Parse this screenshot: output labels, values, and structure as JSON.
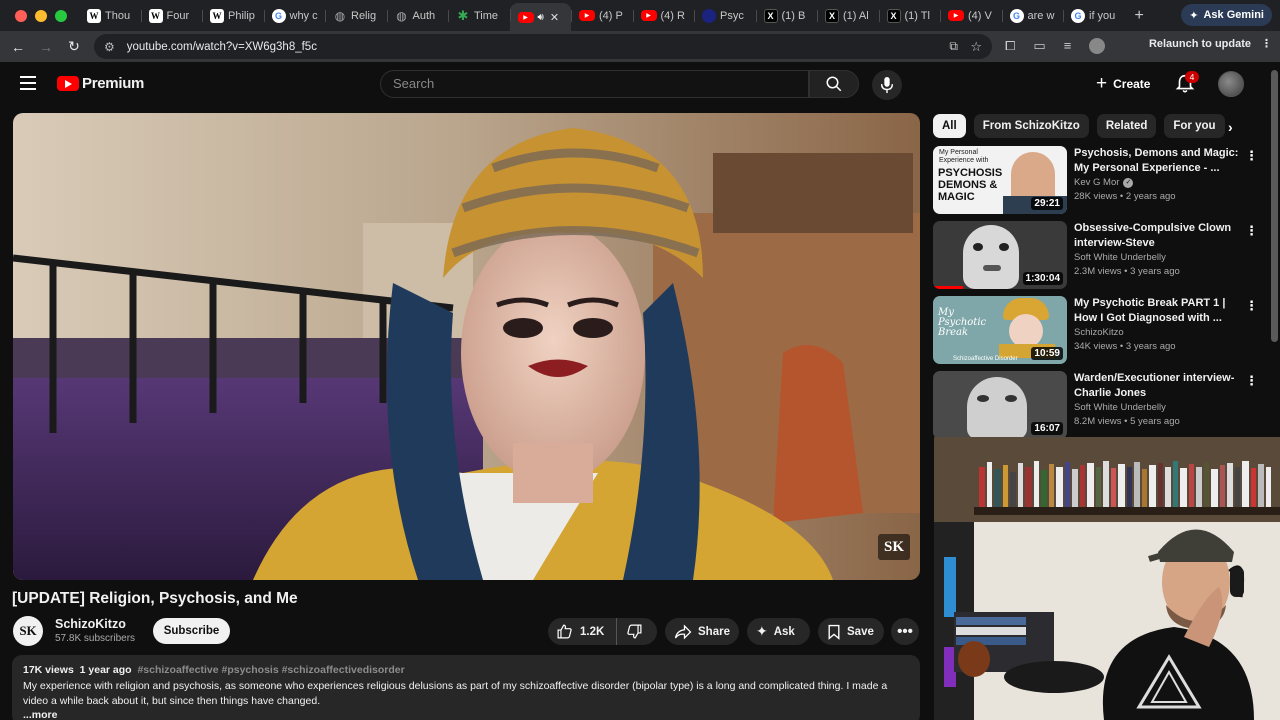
{
  "browser": {
    "tabs": [
      {
        "label": "Thou",
        "favicon": "wikipedia-icon"
      },
      {
        "label": "Four",
        "favicon": "wikipedia-icon"
      },
      {
        "label": "Philip",
        "favicon": "wikipedia-icon"
      },
      {
        "label": "why c",
        "favicon": "google-icon"
      },
      {
        "label": "Relig",
        "favicon": "globe-icon"
      },
      {
        "label": "Auth",
        "favicon": "globe-icon"
      },
      {
        "label": "Time",
        "favicon": "leaf-icon"
      },
      {
        "label": "",
        "favicon": "youtube-icon",
        "active": true
      },
      {
        "label": "(4) P",
        "favicon": "youtube-icon"
      },
      {
        "label": "(4) R",
        "favicon": "youtube-icon"
      },
      {
        "label": "Psyc",
        "favicon": "psych-icon"
      },
      {
        "label": "(1) B",
        "favicon": "x-icon"
      },
      {
        "label": "(1) Al",
        "favicon": "x-icon"
      },
      {
        "label": "(1) Tl",
        "favicon": "x-icon"
      },
      {
        "label": "(4) V",
        "favicon": "youtube-icon"
      },
      {
        "label": "are w",
        "favicon": "google-icon"
      },
      {
        "label": "if you",
        "favicon": "google-icon"
      }
    ],
    "ask_gemini": "Ask Gemini",
    "url": "youtube.com/watch?v=XW6g3h8_f5c",
    "relaunch": "Relaunch to update"
  },
  "youtube": {
    "logo_text": "Premium",
    "search_placeholder": "Search",
    "create_label": "Create",
    "notification_count": "4"
  },
  "video": {
    "title": "[UPDATE] Religion, Psychosis, and Me",
    "watermark": "SK",
    "channel": {
      "avatar_text": "SK",
      "name": "SchizoKitzo",
      "subscribers": "57.8K subscribers"
    },
    "subscribe_label": "Subscribe",
    "like_count": "1.2K",
    "share_label": "Share",
    "ask_label": "Ask",
    "save_label": "Save",
    "description": {
      "views": "17K views",
      "age": "1 year ago",
      "tags": "#schizoaffective #psychosis #schizoaffectivedisorder",
      "text": "My experience with religion and psychosis, as someone who experiences religious delusions as part of my schizoaffective disorder (bipolar type) is a long and complicated thing. I made a video a while back about it, but since then things have changed.",
      "more": "...more"
    }
  },
  "sidebar": {
    "chips": [
      "All",
      "From SchizoKitzo",
      "Related",
      "For you"
    ],
    "recommendations": [
      {
        "title": "Psychosis, Demons and Magic: My Personal Experience - ...",
        "channel": "Kev G Mor",
        "verified": true,
        "meta": "28K views • 2 years ago",
        "duration": "29:21",
        "thumb_text": [
          "My Personal",
          "Experience with",
          "PSYCHOSIS",
          "DEMONS &",
          "MAGIC"
        ]
      },
      {
        "title": "Obsessive-Compulsive Clown interview-Steve",
        "channel": "Soft White Underbelly",
        "verified": false,
        "meta": "2.3M views • 3 years ago",
        "duration": "1:30:04"
      },
      {
        "title": "My Psychotic Break PART 1 | How I Got Diagnosed with ...",
        "channel": "SchizoKitzo",
        "verified": false,
        "meta": "34K views • 3 years ago",
        "duration": "10:59",
        "thumb_text": [
          "My",
          "Psychotic",
          "Break",
          "Schizoaffective Disorder"
        ]
      },
      {
        "title": "Warden/Executioner interview-Charlie Jones",
        "channel": "Soft White Underbelly",
        "verified": false,
        "meta": "8.2M views • 5 years ago",
        "duration": "16:07"
      }
    ]
  },
  "colors": {
    "youtube_red": "#ff0000",
    "background": "#0f0f0f",
    "pill": "#272727",
    "notification_badge": "#cc0000"
  }
}
